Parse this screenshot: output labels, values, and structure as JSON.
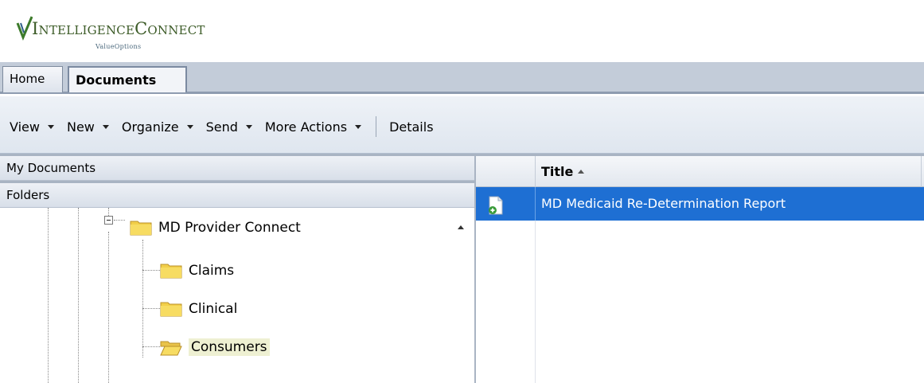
{
  "header": {
    "brand_prefix": "I",
    "brand_main": "NTELLIGENCE",
    "brand_prefix2": "C",
    "brand_main2": "ONNECT",
    "sub": "ValueOptions"
  },
  "tabs": [
    {
      "label": "Home",
      "active": false
    },
    {
      "label": "Documents",
      "active": true
    }
  ],
  "toolbar": {
    "items": [
      {
        "label": "View",
        "dropdown": true
      },
      {
        "label": "New",
        "dropdown": true
      },
      {
        "label": "Organize",
        "dropdown": true
      },
      {
        "label": "Send",
        "dropdown": true
      },
      {
        "label": "More Actions",
        "dropdown": true
      }
    ],
    "details_label": "Details"
  },
  "left_panel": {
    "my_documents": "My Documents",
    "folders": "Folders",
    "tree": {
      "root": {
        "label": "MD Provider Connect",
        "expanded": true,
        "icon": "folder-icon"
      },
      "children": [
        {
          "label": "Claims",
          "icon": "folder-icon",
          "selected": false
        },
        {
          "label": "Clinical",
          "icon": "folder-icon",
          "selected": false
        },
        {
          "label": "Consumers",
          "icon": "folder-open-icon",
          "selected": true
        }
      ]
    }
  },
  "grid": {
    "column_title": "Title",
    "sort": "ascending",
    "rows": [
      {
        "title": "MD Medicaid Re-Determination Report",
        "icon": "document-add-icon",
        "selected": true
      }
    ]
  },
  "colors": {
    "selection": "#1e6fd3",
    "brand_green": "#3c5b27",
    "folder": "#f2cf4a"
  }
}
